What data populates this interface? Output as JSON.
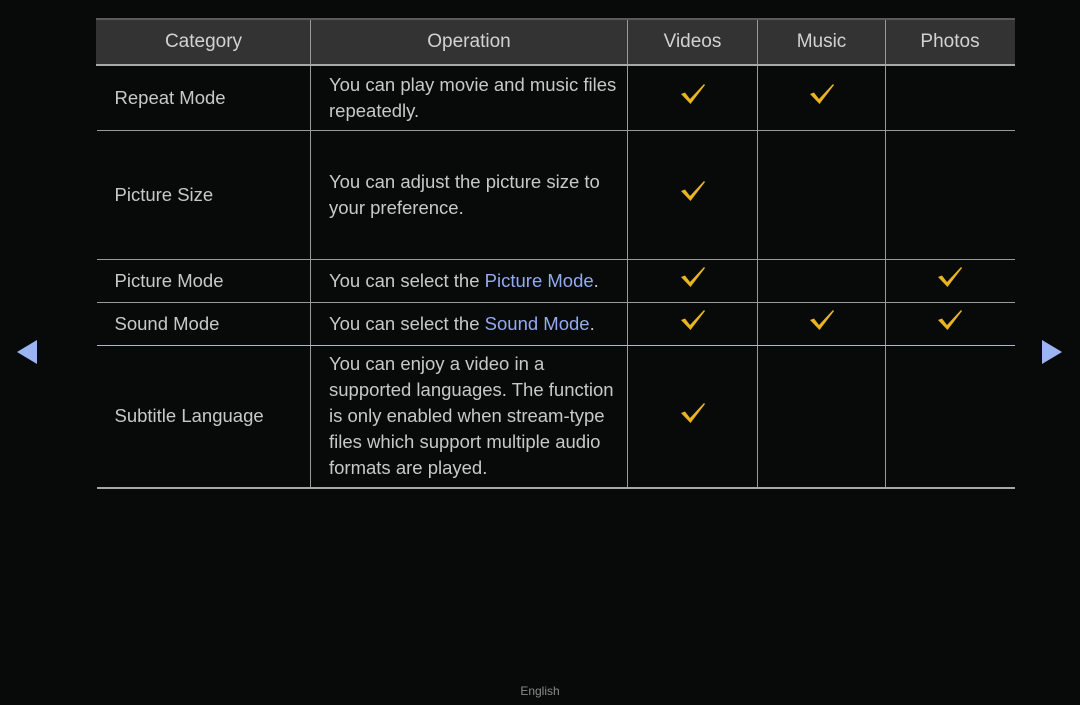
{
  "table": {
    "headers": [
      "Category",
      "Operation",
      "Videos",
      "Music",
      "Photos"
    ],
    "rows": [
      {
        "category": "Repeat Mode",
        "operation": {
          "pre": "You can play movie and music files repeatedly.",
          "hl": "",
          "post": ""
        },
        "videos": true,
        "music": true,
        "photos": false
      },
      {
        "category": "Picture Size",
        "operation": {
          "pre": "You can adjust the picture size to your preference.",
          "hl": "",
          "post": ""
        },
        "videos": true,
        "music": false,
        "photos": false
      },
      {
        "category": "Picture Mode",
        "operation": {
          "pre": "You can select the ",
          "hl": "Picture Mode",
          "post": "."
        },
        "videos": true,
        "music": false,
        "photos": true
      },
      {
        "category": "Sound Mode",
        "operation": {
          "pre": "You can select the ",
          "hl": "Sound Mode",
          "post": "."
        },
        "videos": true,
        "music": true,
        "photos": true
      },
      {
        "category": "Subtitle Language",
        "operation": {
          "pre": "You can enjoy a video in a supported languages. The function is only enabled when stream-type files which support multiple audio formats are played.",
          "hl": "",
          "post": ""
        },
        "videos": true,
        "music": false,
        "photos": false
      }
    ]
  },
  "navigation": {
    "prev_icon": "triangle-left-icon",
    "next_icon": "triangle-right-icon"
  },
  "footer": {
    "language": "English"
  },
  "colors": {
    "accent": "#92aaf0",
    "check": "#e8b420",
    "header_bg": "#333333",
    "background": "#080a0a"
  }
}
